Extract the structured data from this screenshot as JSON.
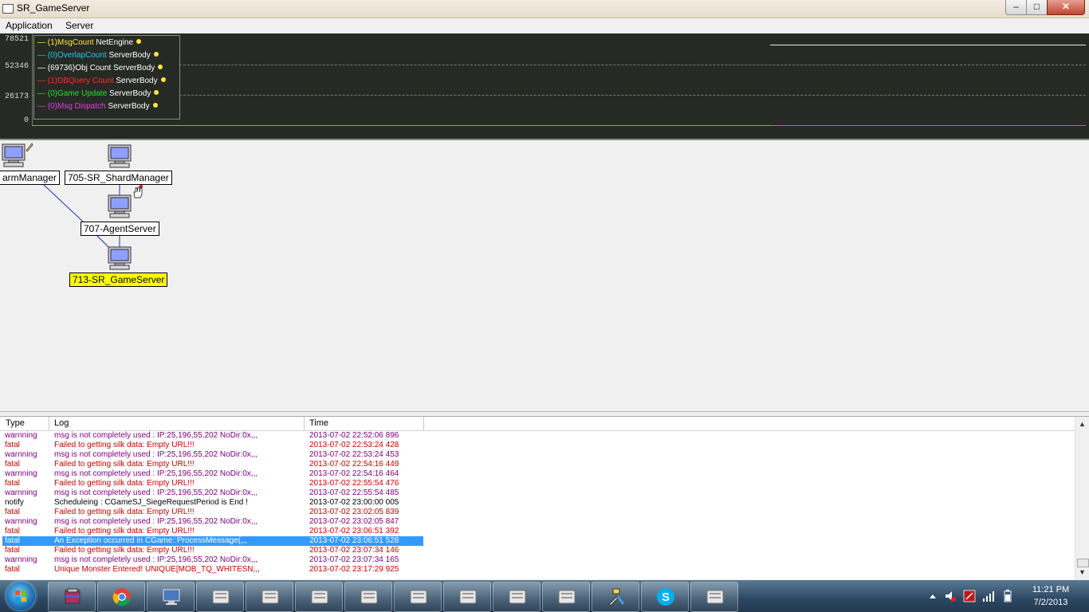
{
  "window": {
    "title": "SR_GameServer",
    "min_glyph": "–",
    "max_glyph": "□",
    "close_glyph": "✕"
  },
  "menu": [
    "Application",
    "Server"
  ],
  "graph": {
    "y_ticks": [
      "78521",
      "52346",
      "26173",
      "0"
    ],
    "legend": [
      {
        "name": "— (1)MsgCount",
        "group": "NetEngine",
        "color": "#ffe53a"
      },
      {
        "name": "— (0)OverlapCount",
        "group": "ServerBody",
        "color": "#27c6e6"
      },
      {
        "name": "— (69736)Obj Count",
        "group": "ServerBody",
        "color": "#ffffff"
      },
      {
        "name": "— (1)DBQuery Count",
        "group": "ServerBody",
        "color": "#ff2a2a"
      },
      {
        "name": "— (0)Game Update",
        "group": "ServerBody",
        "color": "#27e02a"
      },
      {
        "name": "— (0)Msg Dispatch",
        "group": "ServerBody",
        "color": "#ea36ea"
      }
    ]
  },
  "nodes": {
    "farm_manager": "armManager",
    "shard_manager": "705-SR_ShardManager",
    "agent_server": "707-AgentServer",
    "game_server": "713-SR_GameServer"
  },
  "log": {
    "columns": [
      "Type",
      "Log",
      "Time"
    ],
    "rows": [
      {
        "type": "warnning",
        "log": "msg is not completely used : IP:25,196,55,202 NoDir:0x,,,",
        "time": "2013-07-02 22:52:06 896",
        "color": "#800080"
      },
      {
        "type": "fatal",
        "log": "Failed to getting silk data: Empty URL!!!",
        "time": "2013-07-02 22:53:24 428",
        "color": "#cc0000"
      },
      {
        "type": "warnning",
        "log": "msg is not completely used : IP:25,196,55,202 NoDir:0x,,,",
        "time": "2013-07-02 22:53:24 453",
        "color": "#800080"
      },
      {
        "type": "fatal",
        "log": "Failed to getting silk data: Empty URL!!!",
        "time": "2013-07-02 22:54:16 449",
        "color": "#cc0000"
      },
      {
        "type": "warnning",
        "log": "msg is not completely used : IP:25,196,55,202 NoDir:0x,,,",
        "time": "2013-07-02 22:54:16 464",
        "color": "#800080"
      },
      {
        "type": "fatal",
        "log": "Failed to getting silk data: Empty URL!!!",
        "time": "2013-07-02 22:55:54 476",
        "color": "#cc0000"
      },
      {
        "type": "warnning",
        "log": "msg is not completely used : IP:25,196,55,202 NoDir:0x,,,",
        "time": "2013-07-02 22:55:54 485",
        "color": "#800080"
      },
      {
        "type": "notify",
        "log": "Scheduleing : CGameSJ_SiegeRequestPeriod is End !",
        "time": "2013-07-02 23:00:00 005",
        "color": "#000000"
      },
      {
        "type": "fatal",
        "log": "Failed to getting silk data: Empty URL!!!",
        "time": "2013-07-02 23:02:05 839",
        "color": "#cc0000"
      },
      {
        "type": "warnning",
        "log": "msg is not completely used : IP:25,196,55,202 NoDir:0x,,,",
        "time": "2013-07-02 23:02:05 847",
        "color": "#800080"
      },
      {
        "type": "fatal",
        "log": "Failed to getting silk data: Empty URL!!!",
        "time": "2013-07-02 23:06:51 392",
        "color": "#cc0000"
      },
      {
        "type": "fatal",
        "log": "An Exception occurred in CGame::ProcessMessage(,,,",
        "time": "2013-07-02 23:06:51 528",
        "color": "#cc0000"
      },
      {
        "type": "fatal",
        "log": "Failed to getting silk data: Empty URL!!!",
        "time": "2013-07-02 23:07:34 146",
        "color": "#cc0000"
      },
      {
        "type": "warnning",
        "log": "msg is not completely used : IP:25,196,55,202 NoDir:0x,,,",
        "time": "2013-07-02 23:07:34 165",
        "color": "#800080"
      },
      {
        "type": "fatal",
        "log": "Unique Monster Entered! UNIQUE[MOB_TQ_WHITESN,,,",
        "time": "2013-07-02 23:17:29 925",
        "color": "#cc0000"
      }
    ],
    "selected_index": 11,
    "scroll_up": "▲",
    "scroll_down": "▼"
  },
  "taskbar": {
    "apps": [
      "winrar-icon",
      "chrome-icon",
      "remote-desktop-icon",
      "server-app-icon",
      "server-app-icon",
      "server-app-icon",
      "server-app-icon",
      "server-app-icon",
      "server-app-icon",
      "server-app-icon",
      "server-app-icon",
      "tools-icon",
      "skype-icon",
      "server-app-icon"
    ],
    "clock_time": "11:21 PM",
    "clock_date": "7/2/2013"
  }
}
